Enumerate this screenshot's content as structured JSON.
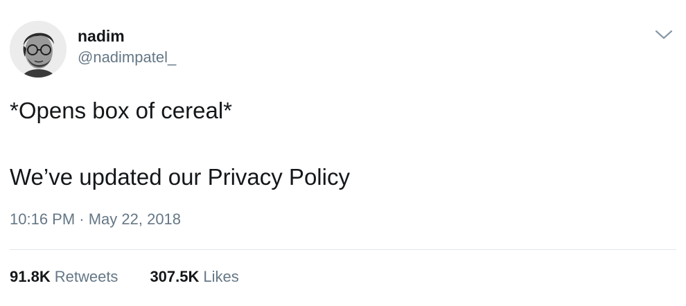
{
  "author": {
    "name": "nadim",
    "handle": "@nadimpatel_",
    "avatar_icon": "profile-photo"
  },
  "menu": {
    "icon": "chevron-down-icon"
  },
  "tweet": {
    "lines": [
      "*Opens box of cereal*",
      "We’ve updated our Privacy Policy"
    ],
    "timestamp": "10:16 PM · May 22, 2018"
  },
  "stats": {
    "retweets_count": "91.8K",
    "retweets_label": "Retweets",
    "likes_count": "307.5K",
    "likes_label": "Likes"
  },
  "colors": {
    "text_primary": "#14171a",
    "text_secondary": "#657786",
    "divider": "#e1e8ed"
  }
}
